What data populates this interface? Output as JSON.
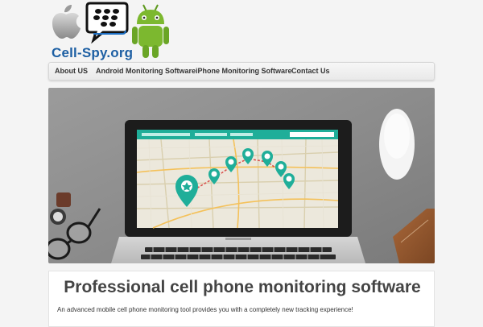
{
  "brand": {
    "logo_text": "Cell-Spy.org",
    "bb_logo_color": "#111111",
    "android_color": "#7cb82f",
    "text_color": "#1d5fa3"
  },
  "nav": {
    "items": [
      {
        "label": "About US"
      },
      {
        "label": "Android Monitoring Software"
      },
      {
        "label": "iPhone Monitoring Software"
      },
      {
        "label": "Contact Us"
      }
    ]
  },
  "hero": {
    "map_accent": "#1fae99",
    "route_color": "#d9534f"
  },
  "main": {
    "headline": "Professional cell phone monitoring software",
    "tagline": "An advanced mobile cell phone monitoring tool provides you with a completely new tracking experience!"
  }
}
